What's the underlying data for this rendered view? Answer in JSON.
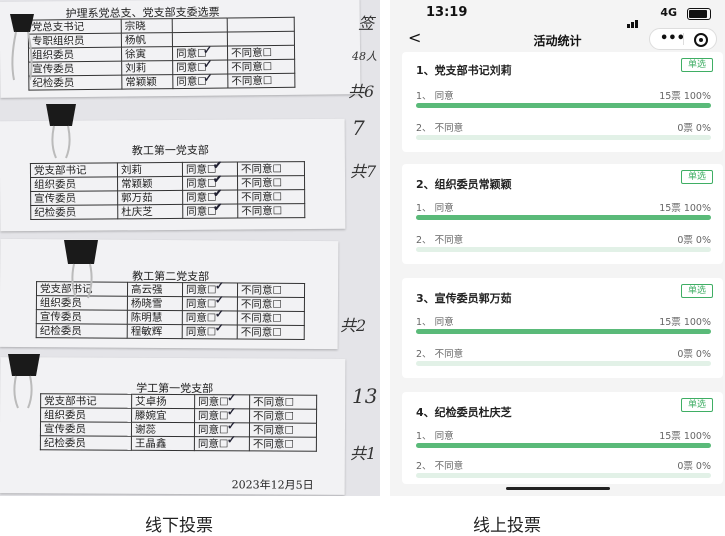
{
  "offline": {
    "caption": "线下投票",
    "sheets": [
      {
        "title": "护理系党总支、党支部支委选票",
        "rows": [
          {
            "role": "党总支书记",
            "name": "宗晓",
            "agree": "",
            "disagree": "",
            "checked": false
          },
          {
            "role": "专职组织员",
            "name": "杨帆",
            "agree": "",
            "disagree": "",
            "checked": false
          },
          {
            "role": "组织委员",
            "name": "徐寅",
            "agree": "同意☐",
            "disagree": "不同意☐",
            "checked": true
          },
          {
            "role": "宣传委员",
            "name": "刘莉",
            "agree": "同意☐",
            "disagree": "不同意☐",
            "checked": true
          },
          {
            "role": "纪检委员",
            "name": "常颖颖",
            "agree": "同意☐",
            "disagree": "不同意☐",
            "checked": true
          }
        ],
        "handwriting": [
          "签",
          "48人",
          "共6"
        ]
      },
      {
        "title": "教工第一党支部",
        "rows": [
          {
            "role": "党支部书记",
            "name": "刘莉",
            "agree": "同意☐",
            "disagree": "不同意☐",
            "checked": true
          },
          {
            "role": "组织委员",
            "name": "常颖颖",
            "agree": "同意☐",
            "disagree": "不同意☐",
            "checked": true
          },
          {
            "role": "宣传委员",
            "name": "郭万茹",
            "agree": "同意☐",
            "disagree": "不同意☐",
            "checked": true
          },
          {
            "role": "纪检委员",
            "name": "杜庆芝",
            "agree": "同意☐",
            "disagree": "不同意☐",
            "checked": true
          }
        ],
        "handwriting": [
          "7",
          "共7"
        ]
      },
      {
        "title": "教工第二党支部",
        "rows": [
          {
            "role": "党支部书记",
            "name": "高云强",
            "agree": "同意☐",
            "disagree": "不同意☐",
            "checked": true
          },
          {
            "role": "组织委员",
            "name": "杨晓雪",
            "agree": "同意☐",
            "disagree": "不同意☐",
            "checked": true
          },
          {
            "role": "宣传委员",
            "name": "陈明慧",
            "agree": "同意☐",
            "disagree": "不同意☐",
            "checked": true
          },
          {
            "role": "纪检委员",
            "name": "程敏辉",
            "agree": "同意☐",
            "disagree": "不同意☐",
            "checked": true
          }
        ],
        "handwriting": [
          "共2"
        ]
      },
      {
        "title": "学工第一党支部",
        "rows": [
          {
            "role": "党支部书记",
            "name": "艾卓扬",
            "agree": "同意☐",
            "disagree": "不同意☐",
            "checked": true
          },
          {
            "role": "组织委员",
            "name": "滕婉宜",
            "agree": "同意☐",
            "disagree": "不同意☐",
            "checked": true
          },
          {
            "role": "宣传委员",
            "name": "谢蕊",
            "agree": "同意☐",
            "disagree": "不同意☐",
            "checked": true
          },
          {
            "role": "纪检委员",
            "name": "王晶鑫",
            "agree": "同意☐",
            "disagree": "不同意☐",
            "checked": true
          }
        ],
        "handwriting": [
          "13",
          "共1"
        ],
        "date": "2023年12月5日"
      }
    ]
  },
  "online": {
    "caption": "线上投票",
    "status": {
      "time": "13:19",
      "network": "4G"
    },
    "nav": {
      "title": "活动统计",
      "back": "<",
      "more": "•••"
    },
    "accent": "#5aba79",
    "questions": [
      {
        "title": "1、党支部书记刘莉",
        "badge": "单选",
        "options": [
          {
            "label": "1、 同意",
            "stat": "15票 100%",
            "pct": 100
          },
          {
            "label": "2、 不同意",
            "stat": "0票 0%",
            "pct": 0
          }
        ]
      },
      {
        "title": "2、组织委员常颖颖",
        "badge": "单选",
        "options": [
          {
            "label": "1、 同意",
            "stat": "15票 100%",
            "pct": 100
          },
          {
            "label": "2、 不同意",
            "stat": "0票 0%",
            "pct": 0
          }
        ]
      },
      {
        "title": "3、宣传委员郭万茹",
        "badge": "单选",
        "options": [
          {
            "label": "1、 同意",
            "stat": "15票 100%",
            "pct": 100
          },
          {
            "label": "2、 不同意",
            "stat": "0票 0%",
            "pct": 0
          }
        ]
      },
      {
        "title": "4、纪检委员杜庆芝",
        "badge": "单选",
        "options": [
          {
            "label": "1、 同意",
            "stat": "15票 100%",
            "pct": 100
          },
          {
            "label": "2、 不同意",
            "stat": "0票 0%",
            "pct": 0
          }
        ]
      }
    ]
  }
}
